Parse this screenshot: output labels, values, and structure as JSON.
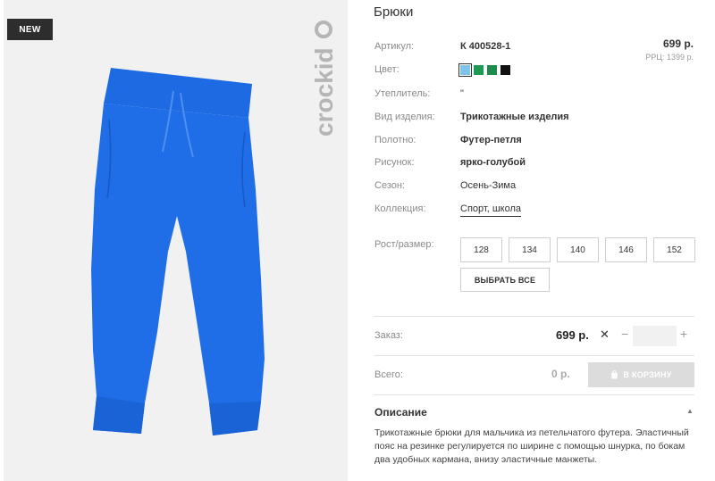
{
  "product": {
    "badge": "NEW",
    "brand": "crockid",
    "title": "Брюки",
    "price": "699 р.",
    "rrc_price": "РРЦ: 1399 р."
  },
  "attributes": [
    {
      "label": "Артикул:",
      "value": "К 400528-1"
    },
    {
      "label": "Цвет:",
      "value": ""
    },
    {
      "label": "Утеплитель:",
      "value": "\""
    },
    {
      "label": "Вид изделия:",
      "value": "Трикотажные изделия"
    },
    {
      "label": "Полотно:",
      "value": "Футер-петля"
    },
    {
      "label": "Рисунок:",
      "value": "ярко-голубой"
    },
    {
      "label": "Сезон:",
      "value": "Осень-Зима"
    },
    {
      "label": "Коллекция:",
      "value": "Спорт, школа"
    }
  ],
  "colors": [
    {
      "name": "light-blue",
      "hex": "#7cc4ec"
    },
    {
      "name": "green-1",
      "hex": "#1f9a55"
    },
    {
      "name": "green-2",
      "hex": "#1e8a4c"
    },
    {
      "name": "black",
      "hex": "#111111"
    }
  ],
  "sizes": {
    "label": "Рост/размер:",
    "options": [
      "128",
      "134",
      "140",
      "146",
      "152"
    ],
    "select_all": "ВЫБРАТЬ ВСЕ"
  },
  "order": {
    "label": "Заказ:",
    "price": "699 р.",
    "times": "✕",
    "minus": "−",
    "plus": "+",
    "quantity": ""
  },
  "total": {
    "label": "Всего:",
    "value": "0 р.",
    "cart_button": "В КОРЗИНУ"
  },
  "description": {
    "title": "Описание",
    "text": "Трикотажные брюки для мальчика из петельчатого футера. Эластичный пояс на резинке регулируется по ширине с помощью шнурка, по бокам два удобных кармана, внизу эластичные манжеты."
  },
  "colors_theme": {
    "product_blue": "#1f6ee8",
    "badge_bg": "#2d2d2d",
    "button_disabled": "#dcdcdc"
  }
}
